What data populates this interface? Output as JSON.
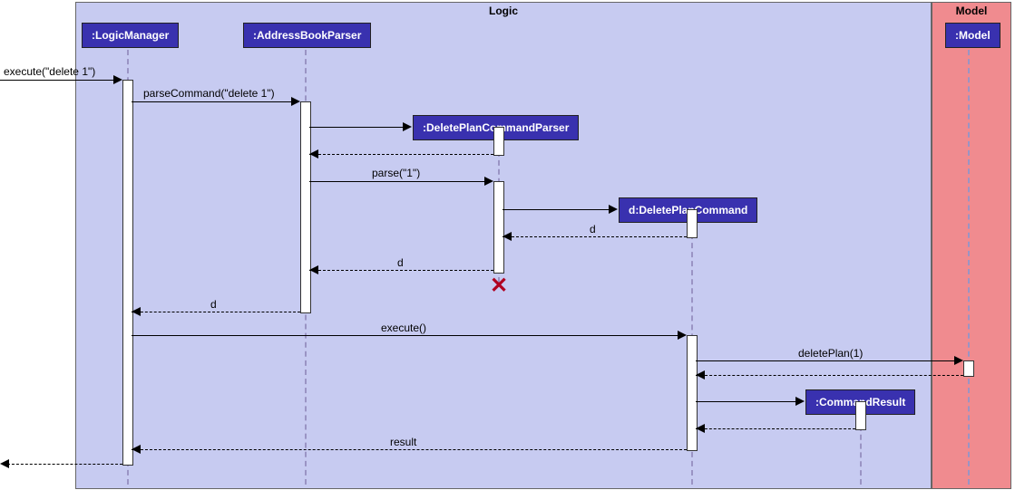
{
  "regions": {
    "logic": {
      "label": "Logic"
    },
    "model": {
      "label": "Model"
    }
  },
  "lifelines": {
    "logicManager": ":LogicManager",
    "addressBookParser": ":AddressBookParser",
    "deletePlanCommandParser": ":DeletePlanCommandParser",
    "deletePlanCommand": "d:DeletePlanCommand",
    "commandResult": ":CommandResult",
    "model": ":Model"
  },
  "messages": {
    "m1": "execute(\"delete 1\")",
    "m2": "parseCommand(\"delete 1\")",
    "m3": "parse(\"1\")",
    "m4": "d",
    "m5": "d",
    "m6": "d",
    "m7": "execute()",
    "m8": "deletePlan(1)",
    "m9": "result"
  },
  "chart_data": {
    "type": "sequence-diagram",
    "participants": [
      {
        "id": "caller",
        "name": "(external caller)",
        "region": null
      },
      {
        "id": "logicManager",
        "name": ":LogicManager",
        "region": "Logic"
      },
      {
        "id": "addressBookParser",
        "name": ":AddressBookParser",
        "region": "Logic"
      },
      {
        "id": "deletePlanCommandParser",
        "name": ":DeletePlanCommandParser",
        "region": "Logic",
        "created_during_sequence": true,
        "destroyed_during_sequence": true
      },
      {
        "id": "deletePlanCommand",
        "name": "d:DeletePlanCommand",
        "region": "Logic",
        "created_during_sequence": true
      },
      {
        "id": "commandResult",
        "name": ":CommandResult",
        "region": "Logic",
        "created_during_sequence": true
      },
      {
        "id": "model",
        "name": ":Model",
        "region": "Model"
      }
    ],
    "regions": [
      "Logic",
      "Model"
    ],
    "interactions": [
      {
        "from": "caller",
        "to": "logicManager",
        "label": "execute(\"delete 1\")",
        "type": "call"
      },
      {
        "from": "logicManager",
        "to": "addressBookParser",
        "label": "parseCommand(\"delete 1\")",
        "type": "call"
      },
      {
        "from": "addressBookParser",
        "to": "deletePlanCommandParser",
        "label": "",
        "type": "create"
      },
      {
        "from": "deletePlanCommandParser",
        "to": "addressBookParser",
        "label": "",
        "type": "return"
      },
      {
        "from": "addressBookParser",
        "to": "deletePlanCommandParser",
        "label": "parse(\"1\")",
        "type": "call"
      },
      {
        "from": "deletePlanCommandParser",
        "to": "deletePlanCommand",
        "label": "",
        "type": "create"
      },
      {
        "from": "deletePlanCommand",
        "to": "deletePlanCommandParser",
        "label": "d",
        "type": "return"
      },
      {
        "from": "deletePlanCommandParser",
        "to": "addressBookParser",
        "label": "d",
        "type": "return"
      },
      {
        "from": "deletePlanCommandParser",
        "to": null,
        "label": "",
        "type": "destroy"
      },
      {
        "from": "addressBookParser",
        "to": "logicManager",
        "label": "d",
        "type": "return"
      },
      {
        "from": "logicManager",
        "to": "deletePlanCommand",
        "label": "execute()",
        "type": "call"
      },
      {
        "from": "deletePlanCommand",
        "to": "model",
        "label": "deletePlan(1)",
        "type": "call"
      },
      {
        "from": "model",
        "to": "deletePlanCommand",
        "label": "",
        "type": "return"
      },
      {
        "from": "deletePlanCommand",
        "to": "commandResult",
        "label": "",
        "type": "create"
      },
      {
        "from": "commandResult",
        "to": "deletePlanCommand",
        "label": "",
        "type": "return"
      },
      {
        "from": "deletePlanCommand",
        "to": "logicManager",
        "label": "result",
        "type": "return"
      },
      {
        "from": "logicManager",
        "to": "caller",
        "label": "",
        "type": "return"
      }
    ]
  }
}
